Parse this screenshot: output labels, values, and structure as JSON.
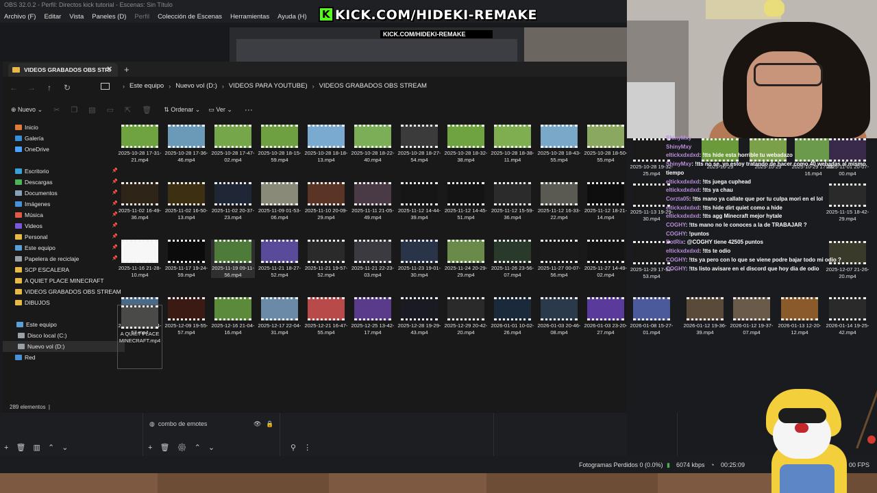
{
  "obs": {
    "title": "OBS 32.0.2 - Perfil: Directos kick tutorial - Escenas: Sin Título",
    "menu": [
      "Archivo (F)",
      "Editar",
      "Vista",
      "Paneles (D)",
      "Perfil",
      "Colección de Escenas",
      "Herramientas",
      "Ayuda (H)"
    ],
    "banner": "KICK.COM/HIDEKI-REMAKE",
    "mini_banner": "KICK.COM/HIDEKI-REMAKE",
    "source_item": "combo de emotes",
    "status": {
      "dropped": "Fotogramas Perdidos 0 (0.0%)",
      "bitrate": "6074 kbps",
      "time": "00:25:09",
      "fps": "00 FPS"
    }
  },
  "explorer": {
    "tab_title": "VIDEOS GRABADOS OBS STRI",
    "breadcrumb": [
      "Este equipo",
      "Nuevo vol (D:)",
      "VIDEOS PARA YOUTUBE)",
      "VIDEOS GRABADOS OBS STREAM"
    ],
    "toolbar": {
      "new": "Nuevo",
      "sort": "Ordenar",
      "view": "Ver",
      "more": "···"
    },
    "sidebar": [
      {
        "label": "Inicio",
        "icon": "home-icon",
        "color": "#e07a3a",
        "pinned": false
      },
      {
        "label": "Galería",
        "icon": "gallery-icon",
        "color": "#3a8fd9",
        "pinned": false
      },
      {
        "label": "OneDrive",
        "icon": "cloud-icon",
        "color": "#4aa3ff",
        "pinned": false
      },
      {
        "label": "Escritorio",
        "icon": "desktop-icon",
        "color": "#3aa0d8",
        "pinned": true
      },
      {
        "label": "Descargas",
        "icon": "download-icon",
        "color": "#4fb35a",
        "pinned": true
      },
      {
        "label": "Documentos",
        "icon": "document-icon",
        "color": "#8aa0b8",
        "pinned": true
      },
      {
        "label": "Imágenes",
        "icon": "image-icon",
        "color": "#4a90d9",
        "pinned": true
      },
      {
        "label": "Música",
        "icon": "music-icon",
        "color": "#e05a4a",
        "pinned": true
      },
      {
        "label": "Videos",
        "icon": "video-icon",
        "color": "#7a5ad9",
        "pinned": true
      },
      {
        "label": "Personal",
        "icon": "folder-icon",
        "color": "#e8b948",
        "pinned": true
      },
      {
        "label": "Este equipo",
        "icon": "pc-icon",
        "color": "#5aa0d8",
        "pinned": true
      },
      {
        "label": "Papelera de reciclaje",
        "icon": "recycle-bin-icon",
        "color": "#9aa0a8",
        "pinned": true
      },
      {
        "label": "SCP ESCALERA",
        "icon": "folder-icon",
        "color": "#e8b948",
        "pinned": false
      },
      {
        "label": "A QUIET PLACE MINECRAFT",
        "icon": "folder-icon",
        "color": "#e8b948",
        "pinned": false
      },
      {
        "label": "VIDEOS GRABADOS OBS STREAM",
        "icon": "folder-icon",
        "color": "#e8b948",
        "pinned": false
      },
      {
        "label": "DIBUJOS",
        "icon": "folder-icon",
        "color": "#e8b948",
        "pinned": false
      },
      {
        "label": "Este equipo",
        "icon": "pc-icon",
        "color": "#5aa0d8",
        "pinned": false
      },
      {
        "label": "Disco local (C:)",
        "icon": "drive-icon",
        "color": "#9aa0a8",
        "pinned": false
      },
      {
        "label": "Nuevo vol (D:)",
        "icon": "drive-icon",
        "color": "#9aa0a8",
        "pinned": false
      },
      {
        "label": "Red",
        "icon": "network-icon",
        "color": "#4a90d9",
        "pinned": false
      }
    ],
    "files": [
      {
        "name": "2025-10-28 17-31-21.mp4",
        "color": "#6fa33f"
      },
      {
        "name": "2025-10-28 17-36-46.mp4",
        "color": "#6a9ab8"
      },
      {
        "name": "2025-10-28 17-47-02.mp4",
        "color": "#76a64a"
      },
      {
        "name": "2025-10-28 18-15-59.mp4",
        "color": "#6ea042"
      },
      {
        "name": "2025-10-28 18-18-13.mp4",
        "color": "#7aaad0"
      },
      {
        "name": "2025-10-28 18-22-40.mp4",
        "color": "#7cad57"
      },
      {
        "name": "2025-10-28 18-27-54.mp4",
        "color": "#3b3b3b"
      },
      {
        "name": "2025-10-28 18-32-38.mp4",
        "color": "#6fa33f"
      },
      {
        "name": "2025-10-28 18-38-11.mp4",
        "color": "#7eae4f"
      },
      {
        "name": "2025-10-28 18-43-55.mp4",
        "color": "#7aa8c8"
      },
      {
        "name": "2025-10-28 18-50-55.mp4",
        "color": "#8aa860"
      },
      {
        "name": "2025-11-02 16-49-36.mp4",
        "color": "#2e2418"
      },
      {
        "name": "2025-11-02 16-50-13.mp4",
        "color": "#3d2f12"
      },
      {
        "name": "2025-11-02 20-37-23.mp4",
        "color": "#1f2636"
      },
      {
        "name": "2025-11-09 01-53-06.mp4",
        "color": "#8a8a78"
      },
      {
        "name": "2025-11-10 20-09-29.mp4",
        "color": "#5a3424"
      },
      {
        "name": "2025-11-11 21-05-49.mp4",
        "color": "#4a3a46"
      },
      {
        "name": "2025-11-12 14-44-39.mp4",
        "color": "#161616"
      },
      {
        "name": "2025-11-12 14-45-51.mp4",
        "color": "#141414"
      },
      {
        "name": "2025-11-12 15-59-36.mp4",
        "color": "#2b2b2b"
      },
      {
        "name": "2025-11-12 16-33-22.mp4",
        "color": "#5a5a52"
      },
      {
        "name": "2025-11-12 18-21-14.mp4",
        "color": "#0e0e0e"
      },
      {
        "name": "2025-11-16 21-28-10.mp4",
        "color": "#f7f7f7"
      },
      {
        "name": "2025-11-17 19-24-59.mp4",
        "color": "#0b0b0b"
      },
      {
        "name": "2025-11-19 09-11-56.mp4",
        "color": "#4e7a3a"
      },
      {
        "name": "2025-11-21 18-27-52.mp4",
        "color": "#5a4a9a"
      },
      {
        "name": "2025-11-21 19-57-52.mp4",
        "color": "#2a2a2a"
      },
      {
        "name": "2025-11-21 22-23-03.mp4",
        "color": "#3a3a40"
      },
      {
        "name": "2025-11-23 19-01-30.mp4",
        "color": "#2a3448"
      },
      {
        "name": "2025-11-24 20-29-29.mp4",
        "color": "#6a8a4a"
      },
      {
        "name": "2025-11-26 23-56-07.mp4",
        "color": "#2a3a2a"
      },
      {
        "name": "2025-11-27 00-07-56.mp4",
        "color": "#1a1a1a"
      },
      {
        "name": "2025-11-27 14-49-02.mp4",
        "color": "#141414"
      },
      {
        "name": "2025-12-08 22-44-57.mp4",
        "color": "#4a6a8a"
      },
      {
        "name": "2025-12-09 19-55-57.mp4",
        "color": "#3a1a12"
      },
      {
        "name": "2025-12-16 21-04-16.mp4",
        "color": "#5a8a3a"
      },
      {
        "name": "2025-12-17 22-04-31.mp4",
        "color": "#6a8aa8"
      },
      {
        "name": "2025-12-21 16-47-55.mp4",
        "color": "#b84a4a"
      },
      {
        "name": "2025-12-25 13-42-17.mp4",
        "color": "#5a3a8a"
      },
      {
        "name": "2025-12-28 19-29-43.mp4",
        "color": "#1a1a22"
      },
      {
        "name": "2025-12-29 20-42-20.mp4",
        "color": "#2a2a2a"
      },
      {
        "name": "2026-01-01 10-02-26.mp4",
        "color": "#1a2a3a"
      },
      {
        "name": "2026-01-03 20-46-08.mp4",
        "color": "#2a3a4a"
      },
      {
        "name": "2026-01-03 23-20-27.mp4",
        "color": "#5a3a9a"
      },
      {
        "name": "A QUIET PLACE MINECRAFT.mp4",
        "color": "#4a4a48"
      }
    ],
    "right_files": [
      {
        "name": "2025-10-28 19-32-25.mp4",
        "color": "#1a1a1a"
      },
      {
        "name": "2025-10-29",
        "color": "#6a9a3a"
      },
      {
        "name": "2025-10-29",
        "color": "#7aa04a"
      },
      {
        "name": "2025-10-29 17-26-16.mp4",
        "color": "#6a9a4a"
      },
      {
        "name": "2025-11-01 20-07-00.mp4",
        "color": "#3a2a4a"
      },
      {
        "name": "2025-11-13 19-29-30.mp4",
        "color": "#1a1a1a"
      },
      {
        "name": "2025-11-15 18-42-29.mp4",
        "color": "#2a2a2a"
      },
      {
        "name": "2025-11-29 17-52-53.mp4",
        "color": "#1a1a1a"
      },
      {
        "name": "2025-12-07 21-26-20.mp4",
        "color": "#3a3a2a"
      },
      {
        "name": "2026-01-08 15-27-01.mp4",
        "color": "#4a5a9a"
      },
      {
        "name": "2026-01-12 19-36-39.mp4",
        "color": "#5a4a3a"
      },
      {
        "name": "2026-01-12 19-37-07.mp4",
        "color": "#6a5a4a"
      },
      {
        "name": "2026-01-13 12-20-12.mp4",
        "color": "#8a5a2a"
      },
      {
        "name": "2026-01-14 19-25-42.mp4",
        "color": "#2a2a2a"
      }
    ],
    "status": "289 elementos"
  },
  "chat": [
    {
      "user": "ShinyMxy",
      "msg": ""
    },
    {
      "user": "ShinyMxy",
      "msg": ""
    },
    {
      "user": "eltickxdxdxd",
      "msg": ": !tts hide esta horrible tu webadazo"
    },
    {
      "user": "ShinyMxy",
      "msg": ": !tts no se, yo estoy tratando de hacer como 40 webadas al mismo tiempo"
    },
    {
      "user": "eltickxdxdxd",
      "msg": ": !tts juega cuphead"
    },
    {
      "user": "eltickxdxdxd",
      "msg": ": !tts ya chau"
    },
    {
      "user": "Corzta05",
      "msg": ": !tts mano ya callate que por tu culpa mori en el lol"
    },
    {
      "user": "eltickxdxdxd",
      "msg": ": !tts hide dirt quiet como a hide"
    },
    {
      "user": "eltickxdxdxd",
      "msg": ": !tts agg Minecraft mejor hytale"
    },
    {
      "user": "COGHY",
      "msg": ": !tts mano no le conoces a la de TRABAJAR ?"
    },
    {
      "user": "COGHY",
      "msg": ": !puntos"
    },
    {
      "user": "BotRix",
      "msg": ": @COGHY tiene 42505 puntos"
    },
    {
      "user": "eltickxdxdxd",
      "msg": ": !tts te odio"
    },
    {
      "user": "COGHY",
      "msg": ": !tts ya pero con lo que se viene podre bajar todo mi odio ?"
    },
    {
      "user": "COGHY",
      "msg": ": !tts listo avisare en el discord que hoy dia de odio"
    }
  ]
}
